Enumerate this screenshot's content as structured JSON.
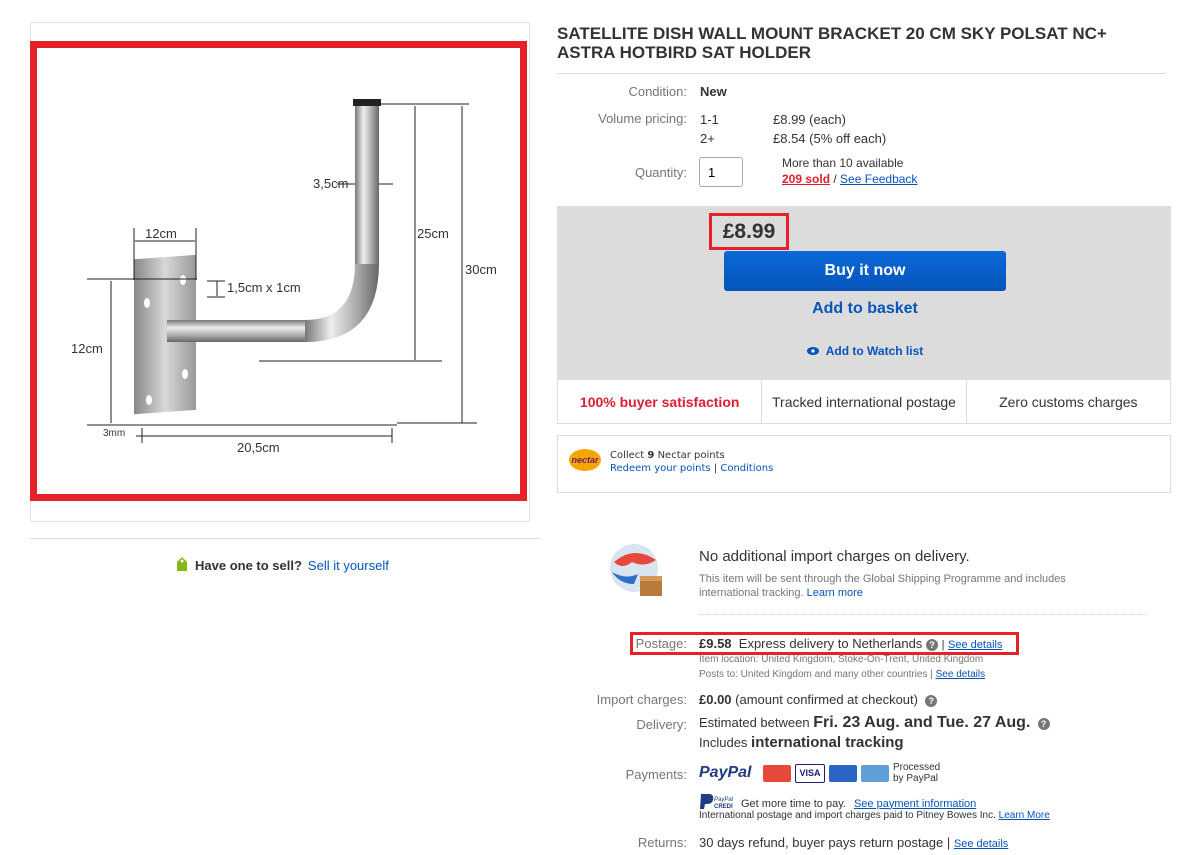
{
  "product": {
    "title": "SATELLITE DISH WALL MOUNT BRACKET 20 CM SKY POLSAT NC+ ASTRA HOTBIRD SAT HOLDER",
    "image_labels": {
      "dim_3_5": "3,5cm",
      "dim_12_top": "12cm",
      "dim_25": "25cm",
      "dim_30": "30cm",
      "dim_hole": "1,5cm x 1cm",
      "dim_12_side": "12cm",
      "dim_3mm": "3mm",
      "dim_20_5": "20,5cm"
    }
  },
  "sell": {
    "question": "Have one to sell?",
    "link": "Sell it yourself"
  },
  "details": {
    "condition_label": "Condition:",
    "condition_value": "New",
    "volume_label": "Volume pricing:",
    "tier1_qty": "1-1",
    "tier1_price": "£8.99  (each)",
    "tier2_qty": "2+",
    "tier2_price": "£8.54  (5% off each)",
    "quantity_label": "Quantity:",
    "quantity_value": "1",
    "available": "More than 10 available",
    "sold": "209 sold",
    "sep": " / ",
    "feedback": "See Feedback"
  },
  "buy": {
    "price": "£8.99",
    "buy_now": "Buy it now",
    "add_basket": "Add to basket",
    "watch": "Add to Watch list"
  },
  "badges": {
    "satisfaction": "100% buyer satisfaction",
    "tracked": "Tracked international postage",
    "customs": "Zero customs charges"
  },
  "nectar": {
    "logo": "nectar",
    "collect_pre": "Collect ",
    "points": "9",
    "collect_post": " Nectar points",
    "redeem": "Redeem your points",
    "sep": " | ",
    "conditions": "Conditions"
  },
  "shipping": {
    "gsp_title": "No additional import charges on delivery.",
    "gsp_desc": "This item will be sent through the Global Shipping Programme and includes international tracking.",
    "learn_more": "Learn more",
    "postage_label": "Postage:",
    "postage_price": "£9.58",
    "postage_desc": "Express delivery to Netherlands",
    "see_details": "See details",
    "item_location": "Item location:  United Kingdom, Stoke-On-Trent, United Kingdom",
    "posts_to": "Posts to:  United Kingdom and many other countries | ",
    "import_label": "Import charges:",
    "import_value": "£0.00",
    "import_note": "(amount confirmed at checkout)",
    "delivery_label": "Delivery:",
    "delivery_pre": "Estimated between ",
    "delivery_dates": "Fri. 23 Aug. and Tue. 27 Aug.",
    "tracking_pre": "Includes ",
    "tracking": "international tracking",
    "payments_label": "Payments:",
    "paypal": "PayPal",
    "processed": "Processed by PayPal",
    "credit_text": "Get more time to pay.",
    "payment_info": "See payment information",
    "pitney": "International postage and import charges paid to Pitney Bowes Inc.",
    "pitney_learn": "Learn More",
    "returns_label": "Returns:",
    "returns_value": "30 days refund, buyer pays return postage | ",
    "returns_details": "See details"
  },
  "colors": {
    "accent_red": "#e62129",
    "link_blue": "#0654ba",
    "buy_box_grey": "#dcdcdc"
  }
}
